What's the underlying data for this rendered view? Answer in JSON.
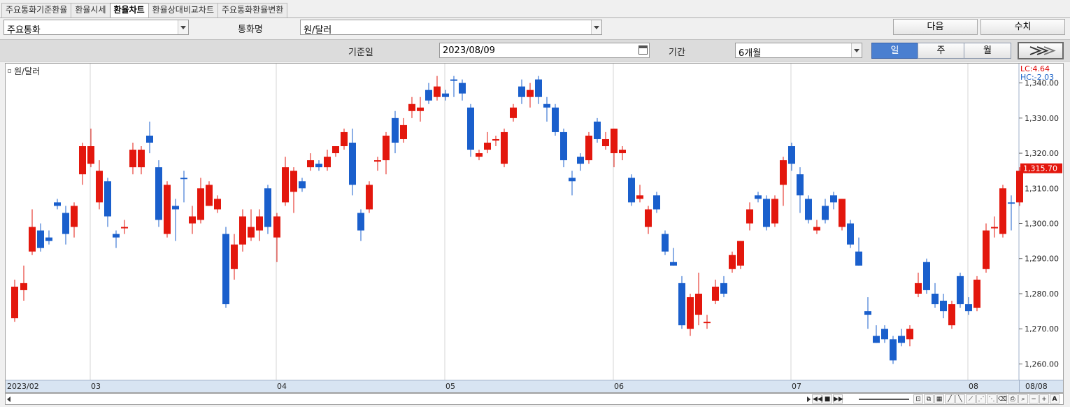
{
  "tabs": [
    "주요통화기준환율",
    "환율시세",
    "환율차트",
    "환율상대비교차트",
    "주요통화환율변환"
  ],
  "active_tab": "환율차트",
  "toolbar": {
    "group_value": "주요통화",
    "currency_label": "통화명",
    "currency_value": "원/달러",
    "next_button": "다음",
    "value_button": "수치"
  },
  "filter": {
    "date_label": "기준일",
    "date_value": "2023/08/09",
    "period_label": "기간",
    "period_value": "6개월",
    "interval": [
      "일",
      "주",
      "월"
    ],
    "interval_selected": "일"
  },
  "indicators": {
    "lc": "LC:4.64",
    "hc": "HC:-2.03"
  },
  "colors": {
    "up": "#e3170d",
    "down": "#1a5fcc",
    "active_interval": "#4a7fd0",
    "axis_bg": "#d8e4f2"
  },
  "chart_data": {
    "type": "candlestick",
    "series_name": "원/달러",
    "x_tick_labels": [
      "2023/02",
      "03",
      "04",
      "05",
      "06",
      "07",
      "08",
      "08/08"
    ],
    "y_tick_labels": [
      "1,340.00",
      "1,330.00",
      "1,320.00",
      "1,310.00",
      "1,300.00",
      "1,290.00",
      "1,280.00",
      "1,270.00",
      "1,260.00"
    ],
    "y_ticks": [
      1340,
      1330,
      1320,
      1310,
      1300,
      1290,
      1280,
      1270,
      1260
    ],
    "ylim": [
      1255.5,
      1345.5
    ],
    "current_price_label": "1,315.70",
    "current_price": 1315.7,
    "grid": true,
    "candles": [
      {
        "x": 13,
        "o": 1273,
        "c": 1282,
        "h": 1284,
        "l": 1272,
        "d": "up"
      },
      {
        "x": 26,
        "o": 1283,
        "c": 1281,
        "h": 1288,
        "l": 1278,
        "d": "up"
      },
      {
        "x": 38,
        "o": 1292,
        "c": 1299,
        "h": 1304,
        "l": 1291,
        "d": "up"
      },
      {
        "x": 50,
        "o": 1298,
        "c": 1293,
        "h": 1300,
        "l": 1292,
        "d": "down"
      },
      {
        "x": 62,
        "o": 1296,
        "c": 1295,
        "h": 1298,
        "l": 1294,
        "d": "down"
      },
      {
        "x": 74,
        "o": 1306,
        "c": 1305,
        "h": 1307,
        "l": 1304,
        "d": "down"
      },
      {
        "x": 86,
        "o": 1303,
        "c": 1297,
        "h": 1305,
        "l": 1294,
        "d": "down"
      },
      {
        "x": 98,
        "o": 1299,
        "c": 1305,
        "h": 1306,
        "l": 1296,
        "d": "up"
      },
      {
        "x": 110,
        "o": 1314,
        "c": 1322,
        "h": 1323,
        "l": 1311,
        "d": "up"
      },
      {
        "x": 122,
        "o": 1317,
        "c": 1322,
        "h": 1327,
        "l": 1316,
        "d": "up"
      },
      {
        "x": 134,
        "o": 1306,
        "c": 1315,
        "h": 1318,
        "l": 1304,
        "d": "up"
      },
      {
        "x": 146,
        "o": 1312,
        "c": 1302,
        "h": 1313,
        "l": 1299,
        "d": "down"
      },
      {
        "x": 158,
        "o": 1297,
        "c": 1296,
        "h": 1298,
        "l": 1293,
        "d": "down"
      },
      {
        "x": 170,
        "o": 1299,
        "c": 1299,
        "h": 1301,
        "l": 1297,
        "d": "up"
      },
      {
        "x": 182,
        "o": 1316,
        "c": 1321,
        "h": 1323,
        "l": 1314,
        "d": "up"
      },
      {
        "x": 194,
        "o": 1316,
        "c": 1321,
        "h": 1322,
        "l": 1314,
        "d": "up"
      },
      {
        "x": 206,
        "o": 1325,
        "c": 1323,
        "h": 1329,
        "l": 1320,
        "d": "down"
      },
      {
        "x": 219,
        "o": 1316,
        "c": 1301,
        "h": 1318,
        "l": 1299,
        "d": "down"
      },
      {
        "x": 231,
        "o": 1297,
        "c": 1311,
        "h": 1312,
        "l": 1296,
        "d": "up"
      },
      {
        "x": 243,
        "o": 1305,
        "c": 1304,
        "h": 1307,
        "l": 1295,
        "d": "down"
      },
      {
        "x": 255,
        "o": 1313,
        "c": 1313,
        "h": 1315,
        "l": 1306,
        "d": "down"
      },
      {
        "x": 267,
        "o": 1300,
        "c": 1302,
        "h": 1305,
        "l": 1297,
        "d": "up"
      },
      {
        "x": 279,
        "o": 1301,
        "c": 1310,
        "h": 1313,
        "l": 1300,
        "d": "up"
      },
      {
        "x": 291,
        "o": 1305,
        "c": 1311,
        "h": 1312,
        "l": 1305,
        "d": "up"
      },
      {
        "x": 303,
        "o": 1304,
        "c": 1307,
        "h": 1308,
        "l": 1303,
        "d": "up"
      },
      {
        "x": 315,
        "o": 1297,
        "c": 1277,
        "h": 1299,
        "l": 1276,
        "d": "down"
      },
      {
        "x": 327,
        "o": 1287,
        "c": 1294,
        "h": 1297,
        "l": 1284,
        "d": "up"
      },
      {
        "x": 339,
        "o": 1294,
        "c": 1302,
        "h": 1304,
        "l": 1292,
        "d": "up"
      },
      {
        "x": 351,
        "o": 1296,
        "c": 1299,
        "h": 1304,
        "l": 1295,
        "d": "up"
      },
      {
        "x": 363,
        "o": 1298,
        "c": 1302,
        "h": 1304,
        "l": 1295,
        "d": "up"
      },
      {
        "x": 375,
        "o": 1310,
        "c": 1299,
        "h": 1311,
        "l": 1297,
        "d": "down"
      },
      {
        "x": 388,
        "o": 1296,
        "c": 1302,
        "h": 1303,
        "l": 1289,
        "d": "up"
      },
      {
        "x": 400,
        "o": 1306,
        "c": 1316,
        "h": 1319,
        "l": 1305,
        "d": "up"
      },
      {
        "x": 412,
        "o": 1309,
        "c": 1315,
        "h": 1316,
        "l": 1303,
        "d": "up"
      },
      {
        "x": 424,
        "o": 1312,
        "c": 1310,
        "h": 1313,
        "l": 1309,
        "d": "down"
      },
      {
        "x": 436,
        "o": 1316,
        "c": 1318,
        "h": 1320,
        "l": 1315,
        "d": "up"
      },
      {
        "x": 448,
        "o": 1317,
        "c": 1316,
        "h": 1318,
        "l": 1315,
        "d": "down"
      },
      {
        "x": 460,
        "o": 1316,
        "c": 1319,
        "h": 1321,
        "l": 1315,
        "d": "up"
      },
      {
        "x": 472,
        "o": 1320,
        "c": 1322,
        "h": 1322,
        "l": 1319,
        "d": "up"
      },
      {
        "x": 484,
        "o": 1322,
        "c": 1326,
        "h": 1327,
        "l": 1321,
        "d": "up"
      },
      {
        "x": 496,
        "o": 1323,
        "c": 1311,
        "h": 1327,
        "l": 1308,
        "d": "down"
      },
      {
        "x": 508,
        "o": 1303,
        "c": 1298,
        "h": 1304,
        "l": 1295,
        "d": "down"
      },
      {
        "x": 520,
        "o": 1304,
        "c": 1311,
        "h": 1312,
        "l": 1303,
        "d": "up"
      },
      {
        "x": 532,
        "o": 1318,
        "c": 1318,
        "h": 1319,
        "l": 1315,
        "d": "up"
      },
      {
        "x": 544,
        "o": 1318,
        "c": 1325,
        "h": 1326,
        "l": 1314,
        "d": "up"
      },
      {
        "x": 557,
        "o": 1330,
        "c": 1323,
        "h": 1332,
        "l": 1320,
        "d": "down"
      },
      {
        "x": 569,
        "o": 1324,
        "c": 1328,
        "h": 1330,
        "l": 1323,
        "d": "up"
      },
      {
        "x": 581,
        "o": 1332,
        "c": 1334,
        "h": 1336,
        "l": 1330,
        "d": "up"
      },
      {
        "x": 593,
        "o": 1332,
        "c": 1333,
        "h": 1336,
        "l": 1329,
        "d": "up"
      },
      {
        "x": 605,
        "o": 1338,
        "c": 1335,
        "h": 1340,
        "l": 1334,
        "d": "down"
      },
      {
        "x": 617,
        "o": 1336,
        "c": 1339,
        "h": 1342,
        "l": 1335,
        "d": "up"
      },
      {
        "x": 629,
        "o": 1337,
        "c": 1336,
        "h": 1338,
        "l": 1335,
        "d": "down"
      },
      {
        "x": 641,
        "o": 1341,
        "c": 1341,
        "h": 1342,
        "l": 1336,
        "d": "down"
      },
      {
        "x": 653,
        "o": 1340,
        "c": 1337,
        "h": 1341,
        "l": 1335,
        "d": "down"
      },
      {
        "x": 665,
        "o": 1333,
        "c": 1321,
        "h": 1334,
        "l": 1319,
        "d": "down"
      },
      {
        "x": 677,
        "o": 1319,
        "c": 1320,
        "h": 1321,
        "l": 1318,
        "d": "up"
      },
      {
        "x": 689,
        "o": 1321,
        "c": 1323,
        "h": 1326,
        "l": 1320,
        "d": "up"
      },
      {
        "x": 701,
        "o": 1324,
        "c": 1324,
        "h": 1325,
        "l": 1322,
        "d": "up"
      },
      {
        "x": 713,
        "o": 1317,
        "c": 1326,
        "h": 1327,
        "l": 1316,
        "d": "up"
      },
      {
        "x": 726,
        "o": 1330,
        "c": 1333,
        "h": 1334,
        "l": 1329,
        "d": "up"
      },
      {
        "x": 738,
        "o": 1339,
        "c": 1336,
        "h": 1341,
        "l": 1334,
        "d": "down"
      },
      {
        "x": 750,
        "o": 1336,
        "c": 1338,
        "h": 1340,
        "l": 1333,
        "d": "up"
      },
      {
        "x": 762,
        "o": 1341,
        "c": 1336,
        "h": 1342,
        "l": 1334,
        "d": "down"
      },
      {
        "x": 774,
        "o": 1334,
        "c": 1333,
        "h": 1336,
        "l": 1329,
        "d": "down"
      },
      {
        "x": 786,
        "o": 1333,
        "c": 1326,
        "h": 1334,
        "l": 1325,
        "d": "down"
      },
      {
        "x": 798,
        "o": 1326,
        "c": 1318,
        "h": 1327,
        "l": 1316,
        "d": "down"
      },
      {
        "x": 810,
        "o": 1313,
        "c": 1312,
        "h": 1315,
        "l": 1308,
        "d": "down"
      },
      {
        "x": 822,
        "o": 1319,
        "c": 1317,
        "h": 1320,
        "l": 1315,
        "d": "down"
      },
      {
        "x": 834,
        "o": 1318,
        "c": 1325,
        "h": 1326,
        "l": 1317,
        "d": "up"
      },
      {
        "x": 846,
        "o": 1329,
        "c": 1324,
        "h": 1330,
        "l": 1323,
        "d": "down"
      },
      {
        "x": 858,
        "o": 1322,
        "c": 1324,
        "h": 1326,
        "l": 1321,
        "d": "up"
      },
      {
        "x": 870,
        "o": 1320,
        "c": 1327,
        "h": 1327,
        "l": 1316,
        "d": "up"
      },
      {
        "x": 882,
        "o": 1320,
        "c": 1321,
        "h": 1322,
        "l": 1318,
        "d": "up"
      },
      {
        "x": 895,
        "o": 1313,
        "c": 1306,
        "h": 1314,
        "l": 1305,
        "d": "down"
      },
      {
        "x": 907,
        "o": 1307,
        "c": 1308,
        "h": 1311,
        "l": 1306,
        "d": "up"
      },
      {
        "x": 919,
        "o": 1299,
        "c": 1304,
        "h": 1305,
        "l": 1297,
        "d": "up"
      },
      {
        "x": 931,
        "o": 1308,
        "c": 1304,
        "h": 1309,
        "l": 1303,
        "d": "down"
      },
      {
        "x": 943,
        "o": 1297,
        "c": 1292,
        "h": 1298,
        "l": 1291,
        "d": "down"
      },
      {
        "x": 955,
        "o": 1289,
        "c": 1288,
        "h": 1293,
        "l": 1288,
        "d": "down"
      },
      {
        "x": 967,
        "o": 1283,
        "c": 1271,
        "h": 1285,
        "l": 1270,
        "d": "down"
      },
      {
        "x": 979,
        "o": 1270,
        "c": 1279,
        "h": 1280,
        "l": 1268,
        "d": "up"
      },
      {
        "x": 991,
        "o": 1274,
        "c": 1280,
        "h": 1286,
        "l": 1271,
        "d": "up"
      },
      {
        "x": 1003,
        "o": 1272,
        "c": 1272,
        "h": 1274,
        "l": 1270,
        "d": "up"
      },
      {
        "x": 1015,
        "o": 1278,
        "c": 1282,
        "h": 1284,
        "l": 1277,
        "d": "up"
      },
      {
        "x": 1027,
        "o": 1283,
        "c": 1280,
        "h": 1285,
        "l": 1279,
        "d": "down"
      },
      {
        "x": 1039,
        "o": 1287,
        "c": 1291,
        "h": 1292,
        "l": 1286,
        "d": "up"
      },
      {
        "x": 1051,
        "o": 1288,
        "c": 1295,
        "h": 1295,
        "l": 1287,
        "d": "up"
      },
      {
        "x": 1064,
        "o": 1300,
        "c": 1304,
        "h": 1306,
        "l": 1298,
        "d": "up"
      },
      {
        "x": 1076,
        "o": 1308,
        "c": 1307,
        "h": 1309,
        "l": 1306,
        "d": "down"
      },
      {
        "x": 1088,
        "o": 1307,
        "c": 1299,
        "h": 1308,
        "l": 1298,
        "d": "down"
      },
      {
        "x": 1100,
        "o": 1300,
        "c": 1307,
        "h": 1308,
        "l": 1299,
        "d": "up"
      },
      {
        "x": 1112,
        "o": 1311,
        "c": 1318,
        "h": 1319,
        "l": 1305,
        "d": "up"
      },
      {
        "x": 1124,
        "o": 1322,
        "c": 1317,
        "h": 1323,
        "l": 1315,
        "d": "down"
      },
      {
        "x": 1136,
        "o": 1314,
        "c": 1308,
        "h": 1316,
        "l": 1303,
        "d": "down"
      },
      {
        "x": 1148,
        "o": 1307,
        "c": 1301,
        "h": 1308,
        "l": 1300,
        "d": "down"
      },
      {
        "x": 1160,
        "o": 1298,
        "c": 1299,
        "h": 1301,
        "l": 1297,
        "d": "up"
      },
      {
        "x": 1172,
        "o": 1305,
        "c": 1301,
        "h": 1307,
        "l": 1300,
        "d": "down"
      },
      {
        "x": 1184,
        "o": 1308,
        "c": 1306,
        "h": 1309,
        "l": 1304,
        "d": "down"
      },
      {
        "x": 1196,
        "o": 1299,
        "c": 1307,
        "h": 1307,
        "l": 1298,
        "d": "up"
      },
      {
        "x": 1208,
        "o": 1300,
        "c": 1294,
        "h": 1301,
        "l": 1293,
        "d": "down"
      },
      {
        "x": 1220,
        "o": 1292,
        "c": 1288,
        "h": 1296,
        "l": 1288,
        "d": "down"
      },
      {
        "x": 1233,
        "o": 1275,
        "c": 1274,
        "h": 1279,
        "l": 1270,
        "d": "down"
      },
      {
        "x": 1245,
        "o": 1268,
        "c": 1266,
        "h": 1271,
        "l": 1266,
        "d": "down"
      },
      {
        "x": 1257,
        "o": 1270,
        "c": 1267,
        "h": 1271,
        "l": 1266,
        "d": "down"
      },
      {
        "x": 1269,
        "o": 1267,
        "c": 1261,
        "h": 1268,
        "l": 1260,
        "d": "down"
      },
      {
        "x": 1281,
        "o": 1268,
        "c": 1266,
        "h": 1270,
        "l": 1265,
        "d": "down"
      },
      {
        "x": 1293,
        "o": 1267,
        "c": 1270,
        "h": 1271,
        "l": 1265,
        "d": "up"
      },
      {
        "x": 1305,
        "o": 1280,
        "c": 1283,
        "h": 1286,
        "l": 1279,
        "d": "up"
      },
      {
        "x": 1317,
        "o": 1289,
        "c": 1281,
        "h": 1290,
        "l": 1280,
        "d": "down"
      },
      {
        "x": 1329,
        "o": 1280,
        "c": 1277,
        "h": 1283,
        "l": 1276,
        "d": "down"
      },
      {
        "x": 1341,
        "o": 1278,
        "c": 1275,
        "h": 1280,
        "l": 1273,
        "d": "down"
      },
      {
        "x": 1353,
        "o": 1271,
        "c": 1277,
        "h": 1278,
        "l": 1270,
        "d": "up"
      },
      {
        "x": 1365,
        "o": 1285,
        "c": 1277,
        "h": 1286,
        "l": 1276,
        "d": "down"
      },
      {
        "x": 1377,
        "o": 1277,
        "c": 1275,
        "h": 1279,
        "l": 1274,
        "d": "down"
      },
      {
        "x": 1389,
        "o": 1276,
        "c": 1284,
        "h": 1285,
        "l": 1275,
        "d": "up"
      },
      {
        "x": 1402,
        "o": 1287,
        "c": 1298,
        "h": 1300,
        "l": 1286,
        "d": "up"
      },
      {
        "x": 1414,
        "o": 1299,
        "c": 1299,
        "h": 1302,
        "l": 1296,
        "d": "up"
      },
      {
        "x": 1426,
        "o": 1297,
        "c": 1310,
        "h": 1311,
        "l": 1296,
        "d": "up"
      },
      {
        "x": 1438,
        "o": 1306,
        "c": 1306,
        "h": 1308,
        "l": 1298,
        "d": "down"
      },
      {
        "x": 1450,
        "o": 1306,
        "c": 1315,
        "h": 1316,
        "l": 1305,
        "d": "up"
      }
    ]
  }
}
